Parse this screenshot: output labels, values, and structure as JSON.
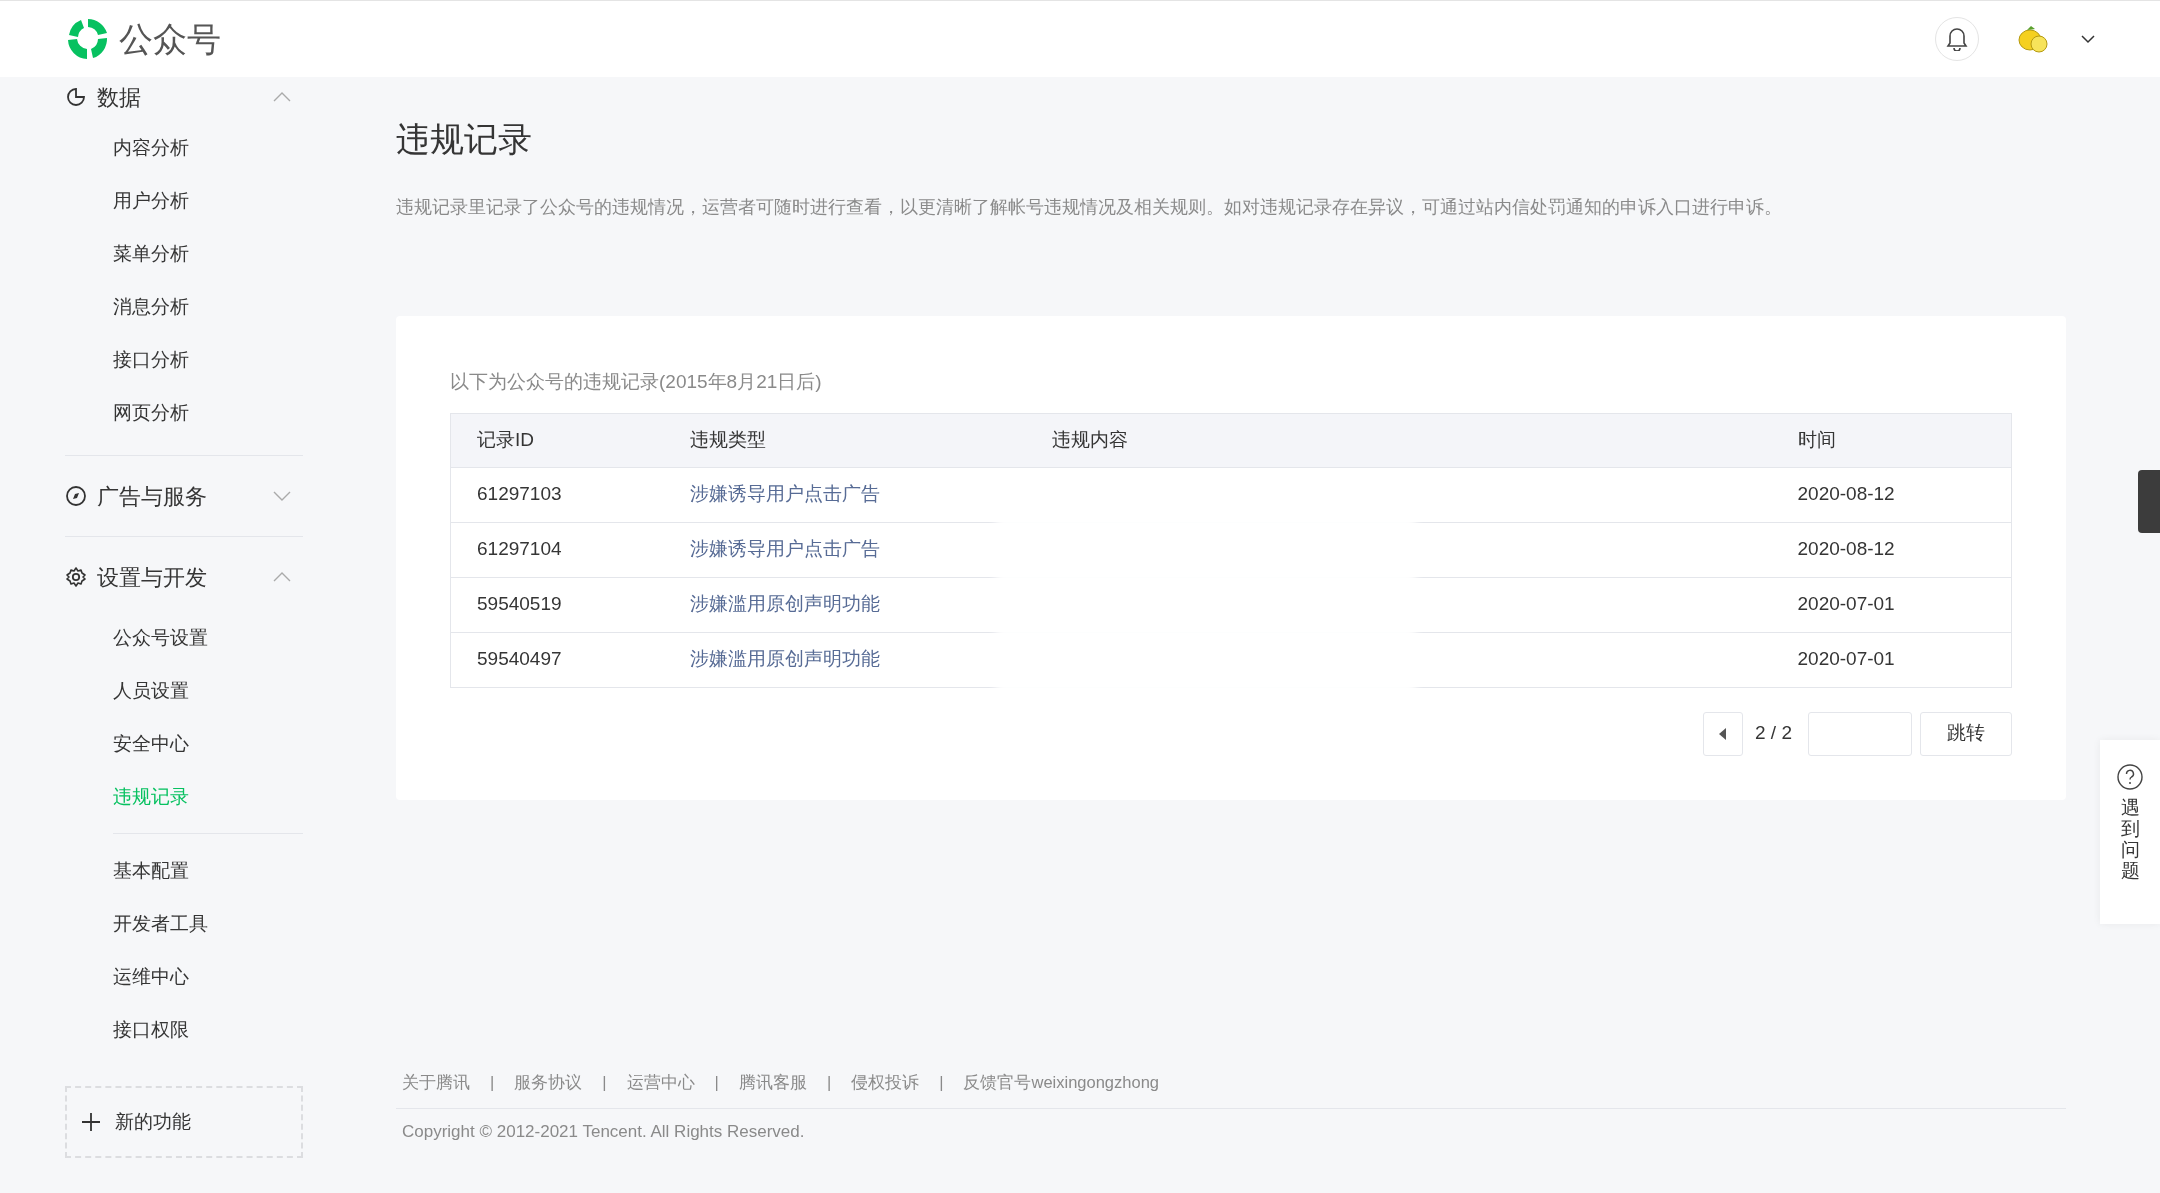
{
  "header": {
    "logo_text": "公众号"
  },
  "sidebar": {
    "groups": [
      {
        "label": "数据",
        "expanded": true,
        "sections": [
          {
            "items": [
              {
                "label": "内容分析",
                "selected": false
              },
              {
                "label": "用户分析",
                "selected": false
              },
              {
                "label": "菜单分析",
                "selected": false
              },
              {
                "label": "消息分析",
                "selected": false
              },
              {
                "label": "接口分析",
                "selected": false
              },
              {
                "label": "网页分析",
                "selected": false
              }
            ]
          }
        ]
      },
      {
        "label": "广告与服务",
        "expanded": false
      },
      {
        "label": "设置与开发",
        "expanded": true,
        "sections": [
          {
            "items": [
              {
                "label": "公众号设置",
                "selected": false
              },
              {
                "label": "人员设置",
                "selected": false
              },
              {
                "label": "安全中心",
                "selected": false
              },
              {
                "label": "违规记录",
                "selected": true
              }
            ]
          },
          {
            "items": [
              {
                "label": "基本配置",
                "selected": false
              },
              {
                "label": "开发者工具",
                "selected": false
              },
              {
                "label": "运维中心",
                "selected": false
              },
              {
                "label": "接口权限",
                "selected": false
              }
            ]
          }
        ]
      }
    ],
    "new_feature": "新的功能"
  },
  "page": {
    "title": "违规记录",
    "description": "违规记录里记录了公众号的违规情况，运营者可随时进行查看，以更清晰了解帐号违规情况及相关规则。如对违规记录存在异议，可通过站内信处罚通知的申诉入口进行申诉。"
  },
  "card": {
    "caption": "以下为公众号的违规记录(2015年8月21日后)",
    "table": {
      "columns": [
        "记录ID",
        "违规类型",
        "违规内容",
        "时间"
      ],
      "rows": [
        {
          "record_id": "61297103",
          "type": "涉嫌诱导用户点击广告",
          "time": "2020-08-12"
        },
        {
          "record_id": "61297104",
          "type": "涉嫌诱导用户点击广告",
          "time": "2020-08-12"
        },
        {
          "record_id": "59540519",
          "type": "涉嫌滥用原创声明功能",
          "time": "2020-07-01"
        },
        {
          "record_id": "59540497",
          "type": "涉嫌滥用原创声明功能",
          "time": "2020-07-01"
        }
      ]
    },
    "pagination": {
      "page_text": "2 / 2",
      "jump_button": "跳转"
    }
  },
  "footer": {
    "separator": "|",
    "links": [
      "关于腾讯",
      "服务协议",
      "运营中心",
      "腾讯客服",
      "侵权投诉",
      "反馈官号weixingongzhong"
    ],
    "copyright": "Copyright © 2012-2021 Tencent. All Rights Reserved."
  },
  "help_widget": {
    "label": "遇到问题"
  }
}
